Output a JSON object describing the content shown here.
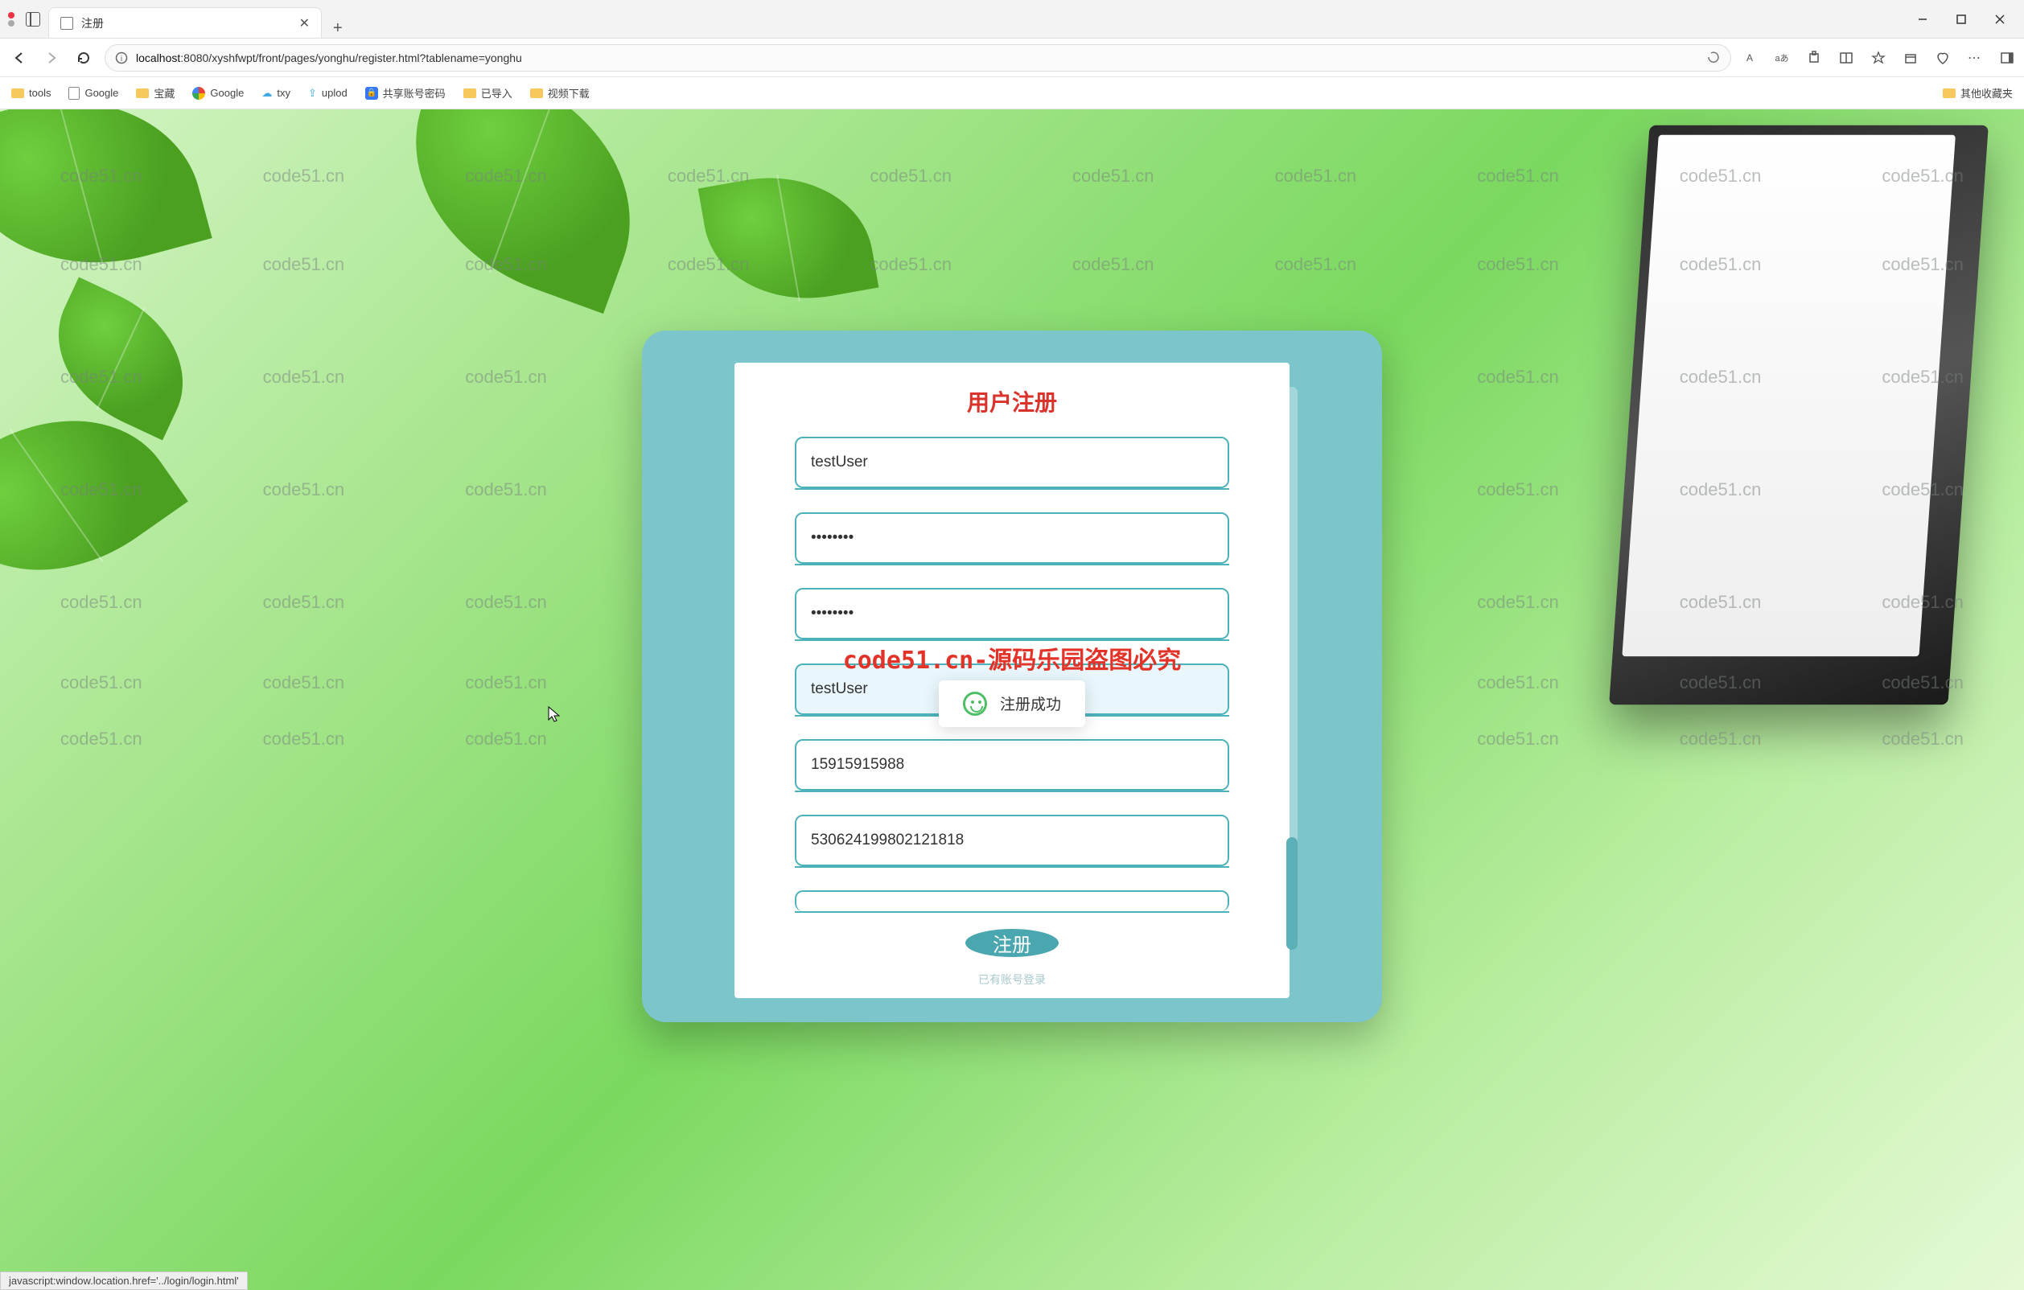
{
  "browser": {
    "tab_title": "注册",
    "url_host": "localhost",
    "url_rest": ":8080/xyshfwpt/front/pages/yonghu/register.html?tablename=yonghu",
    "translate_label": "A",
    "reader_label": "aあ",
    "bookmarks": [
      {
        "label": "tools",
        "icon": "folder"
      },
      {
        "label": "Google",
        "icon": "page"
      },
      {
        "label": "宝藏",
        "icon": "folder"
      },
      {
        "label": "Google",
        "icon": "g"
      },
      {
        "label": "txy",
        "icon": "cloud"
      },
      {
        "label": "uplod",
        "icon": "up"
      },
      {
        "label": "共享账号密码",
        "icon": "lock"
      },
      {
        "label": "已导入",
        "icon": "folder"
      },
      {
        "label": "视频下载",
        "icon": "folder"
      }
    ],
    "other_bookmarks": "其他收藏夹",
    "status_text": "javascript:window.location.href='../login/login.html'"
  },
  "watermark": {
    "text": "code51.cn",
    "center_text": "code51.cn-源码乐园盗图必究"
  },
  "form": {
    "title": "用户注册",
    "fields": [
      {
        "value": "testUser",
        "type": "text"
      },
      {
        "value": "••••••••",
        "type": "password"
      },
      {
        "value": "••••••••",
        "type": "password"
      },
      {
        "value": "testUser",
        "type": "text",
        "active": true
      },
      {
        "value": "15915915988",
        "type": "text"
      },
      {
        "value": "530624199802121818",
        "type": "text"
      }
    ],
    "submit_label": "注册",
    "login_link": "已有账号登录"
  },
  "toast": {
    "message": "注册成功"
  }
}
